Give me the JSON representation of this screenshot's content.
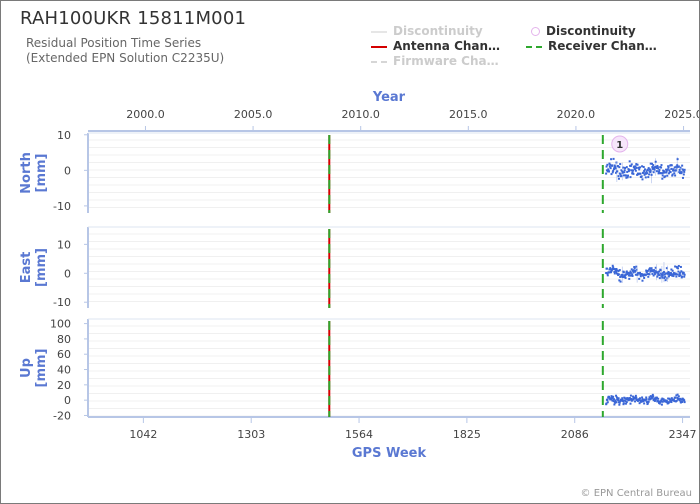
{
  "chart_data": {
    "type": "scatter",
    "title": "RAH100UKR 15811M001",
    "subtitle": [
      "Residual Position Time Series",
      "(Extended EPN Solution C2235U)"
    ],
    "credit": "© EPN Central Bureau",
    "legend": [
      {
        "label": "Discontinuity",
        "style": "line",
        "color": "#e6e6e6",
        "active": false
      },
      {
        "label": "Antenna Chan…",
        "style": "line",
        "color": "#d40000",
        "active": true
      },
      {
        "label": "Firmware Cha…",
        "style": "dashed-line",
        "color": "#d6d6d6",
        "active": false
      },
      {
        "label": "Discontinuity",
        "style": "circle",
        "color": "#e4b4ec",
        "active": true
      },
      {
        "label": "Receiver Chan…",
        "style": "dashed-line",
        "color": "#2ea82e",
        "active": true
      }
    ],
    "x_top": {
      "label": "Year",
      "ticks": [
        "2000.0",
        "2005.0",
        "2010.0",
        "2015.0",
        "2020.0",
        "2025.0"
      ],
      "range": [
        1997.33,
        2025.3
      ]
    },
    "x_bottom": {
      "label": "GPS Week",
      "ticks": [
        "1042",
        "1303",
        "1564",
        "1825",
        "2086",
        "2347"
      ],
      "range": [
        908,
        2365
      ]
    },
    "panels": [
      {
        "label": "North\n[mm]",
        "ticks": [
          "10",
          "0",
          "-10"
        ],
        "tick_values": [
          10,
          0,
          -10
        ],
        "ylim": [
          -12,
          10.5
        ],
        "noise": 1.3
      },
      {
        "label": "East\n[mm]",
        "ticks": [
          "10",
          "0",
          "-10"
        ],
        "tick_values": [
          10,
          0,
          -10
        ],
        "ylim": [
          -12,
          16
        ],
        "noise": 1.3
      },
      {
        "label": "Up\n[mm]",
        "ticks": [
          "100",
          "80",
          "60",
          "40",
          "20",
          "0",
          "-20"
        ],
        "tick_values": [
          100,
          80,
          60,
          40,
          20,
          0,
          -20
        ],
        "ylim": [
          -22,
          106
        ],
        "noise": 3.5
      }
    ],
    "events": [
      {
        "type": "antenna_change",
        "gps_week": 1492,
        "color": "#d40000"
      },
      {
        "type": "receiver_change",
        "gps_week": 1492,
        "color": "#2ea82e"
      },
      {
        "type": "receiver_change",
        "gps_week": 2154,
        "color": "#2ea82e"
      }
    ],
    "discontinuity_markers": [
      {
        "gps_week": 2195,
        "label": "1"
      }
    ],
    "series": {
      "color": "#3a66d6",
      "start_week": 2162,
      "end_week": 2352,
      "step": 1
    }
  }
}
